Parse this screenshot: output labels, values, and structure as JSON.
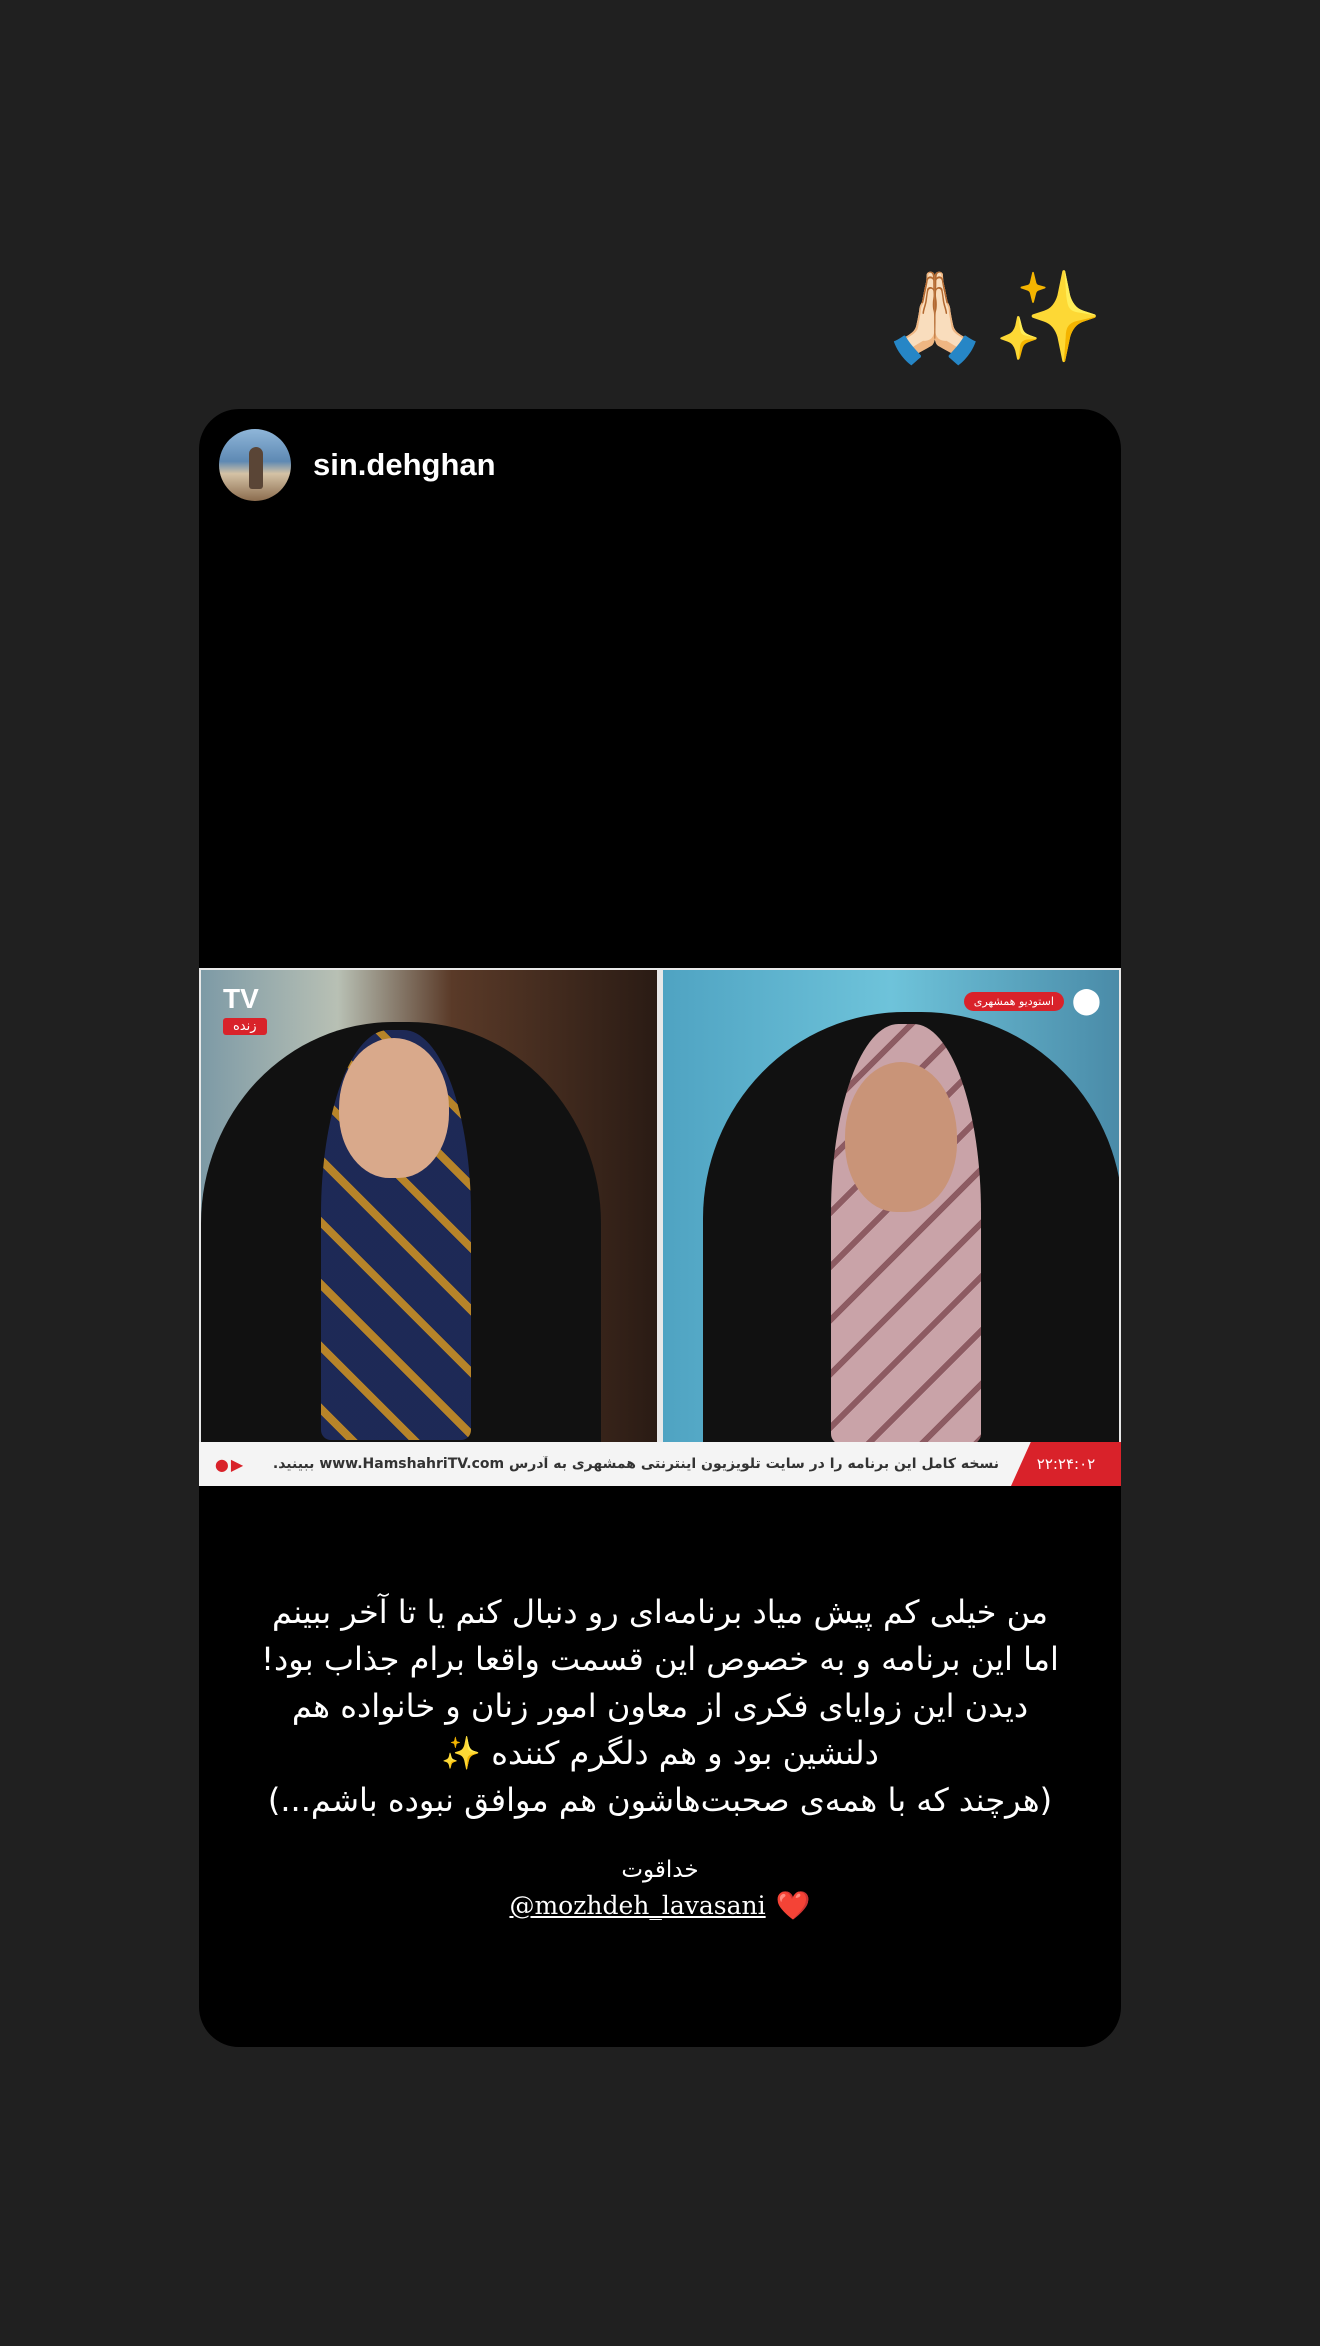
{
  "story": {
    "emoji_text": [
      "🙏🏻",
      "✨"
    ]
  },
  "post": {
    "username": "sin.dehghan",
    "video": {
      "channel_logo": "TV",
      "live_label": "زنده",
      "location_tag": "استودیو همشهری",
      "ticker_text": "نسخه کامل این برنامه را در سایت تلویزیون اینترنتی همشهری به آدرس www.HamshahriTV.com ببینید.",
      "ticker_time": "۲۲:۲۴:۰۲"
    }
  },
  "caption": {
    "lines": [
      "من خیلی کم پیش میاد برنامه‌ای رو دنبال کنم یا تا آخر ببینم",
      "اما این برنامه و به خصوص این قسمت واقعا برام جذاب بود!",
      "دیدن این زوایای فکری از معاون امور زنان و خانواده هم",
      "دلنشین بود و هم دلگرم کننده",
      "(هرچند که با همه‌ی صحبت‌هاشون هم موافق نبوده باشم...)"
    ],
    "sparkle": "✨",
    "thanks": "خداقوت",
    "mention": "@mozhdeh_lavasani",
    "heart": "❤️"
  },
  "colors": {
    "background": "#202020",
    "card": "#000000",
    "accent_red": "#d9222a"
  }
}
